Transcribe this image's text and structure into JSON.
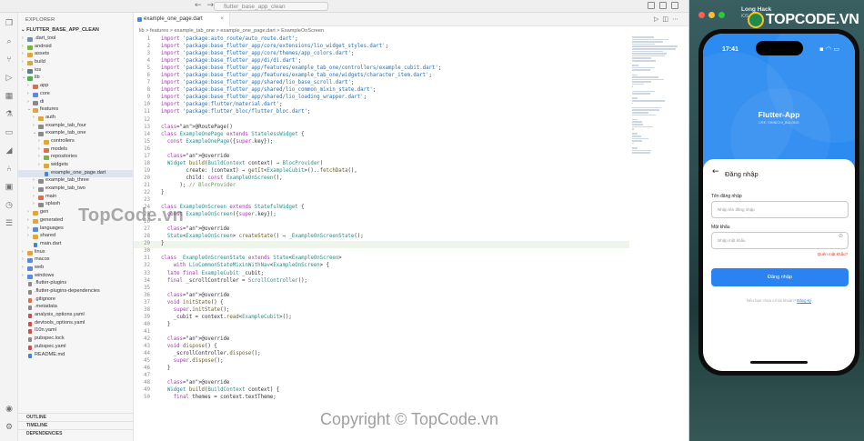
{
  "window": {
    "search_text": "flutter_base_app_clean"
  },
  "sidebar": {
    "title": "EXPLORER",
    "project": "FLUTTER_BASE_APP_CLEAN",
    "tree": [
      {
        "label": ".dart_tool",
        "depth": 0,
        "kind": "folder",
        "open": false,
        "color": "#6d8fbf"
      },
      {
        "label": "android",
        "depth": 0,
        "kind": "folder",
        "open": false,
        "color": "#7cb342"
      },
      {
        "label": "assets",
        "depth": 0,
        "kind": "folder",
        "open": false,
        "color": "#e3a43b"
      },
      {
        "label": "build",
        "depth": 0,
        "kind": "folder",
        "open": false,
        "color": "#e3a43b"
      },
      {
        "label": "ios",
        "depth": 0,
        "kind": "folder",
        "open": false,
        "color": "#607d8b"
      },
      {
        "label": "lib",
        "depth": 0,
        "kind": "folder",
        "open": true,
        "color": "#4caf50"
      },
      {
        "label": "app",
        "depth": 1,
        "kind": "folder",
        "open": false,
        "color": "#e06c4c"
      },
      {
        "label": "core",
        "depth": 1,
        "kind": "folder",
        "open": false,
        "color": "#5c8ad6"
      },
      {
        "label": "di",
        "depth": 1,
        "kind": "folder",
        "open": false,
        "color": "#8a8a8a"
      },
      {
        "label": "features",
        "depth": 1,
        "kind": "folder",
        "open": true,
        "color": "#e3a43b"
      },
      {
        "label": "auth",
        "depth": 2,
        "kind": "folder",
        "open": false,
        "color": "#e3a43b"
      },
      {
        "label": "example_tab_four",
        "depth": 2,
        "kind": "folder",
        "open": false,
        "color": "#8a8a8a"
      },
      {
        "label": "example_tab_one",
        "depth": 2,
        "kind": "folder",
        "open": true,
        "color": "#8a8a8a"
      },
      {
        "label": "controllers",
        "depth": 3,
        "kind": "folder",
        "open": false,
        "color": "#e3a43b"
      },
      {
        "label": "models",
        "depth": 3,
        "kind": "folder",
        "open": false,
        "color": "#e06c4c"
      },
      {
        "label": "repositories",
        "depth": 3,
        "kind": "folder",
        "open": false,
        "color": "#7cb342"
      },
      {
        "label": "widgets",
        "depth": 3,
        "kind": "folder",
        "open": false,
        "color": "#e3a43b"
      },
      {
        "label": "example_one_page.dart",
        "depth": 3,
        "kind": "dart",
        "open": false,
        "color": "#3c8ad9",
        "selected": true
      },
      {
        "label": "example_tab_three",
        "depth": 2,
        "kind": "folder",
        "open": false,
        "color": "#8a8a8a"
      },
      {
        "label": "example_tab_two",
        "depth": 2,
        "kind": "folder",
        "open": false,
        "color": "#8a8a8a"
      },
      {
        "label": "main",
        "depth": 2,
        "kind": "folder",
        "open": false,
        "color": "#e06c4c"
      },
      {
        "label": "splash",
        "depth": 2,
        "kind": "folder",
        "open": false,
        "color": "#8a8a8a"
      },
      {
        "label": "gen",
        "depth": 1,
        "kind": "folder",
        "open": false,
        "color": "#e3a43b"
      },
      {
        "label": "generated",
        "depth": 1,
        "kind": "folder",
        "open": false,
        "color": "#e3a43b"
      },
      {
        "label": "languages",
        "depth": 1,
        "kind": "folder",
        "open": false,
        "color": "#5c8ad6"
      },
      {
        "label": "shared",
        "depth": 1,
        "kind": "folder",
        "open": false,
        "color": "#e3a43b"
      },
      {
        "label": "main.dart",
        "depth": 1,
        "kind": "dart",
        "open": false,
        "color": "#3c8ad9"
      },
      {
        "label": "linux",
        "depth": 0,
        "kind": "folder",
        "open": false,
        "color": "#e3a43b"
      },
      {
        "label": "macos",
        "depth": 0,
        "kind": "folder",
        "open": false,
        "color": "#5c8ad6"
      },
      {
        "label": "web",
        "depth": 0,
        "kind": "folder",
        "open": false,
        "color": "#5c8ad6"
      },
      {
        "label": "windows",
        "depth": 0,
        "kind": "folder",
        "open": false,
        "color": "#5c8ad6"
      },
      {
        "label": ".flutter-plugins",
        "depth": 0,
        "kind": "file",
        "open": false,
        "color": "#8a8a8a"
      },
      {
        "label": ".flutter-plugins-dependencies",
        "depth": 0,
        "kind": "file",
        "open": false,
        "color": "#8a8a8a"
      },
      {
        "label": ".gitignore",
        "depth": 0,
        "kind": "file",
        "open": false,
        "color": "#e06c4c"
      },
      {
        "label": ".metadata",
        "depth": 0,
        "kind": "file",
        "open": false,
        "color": "#8a8a8a"
      },
      {
        "label": "analysis_options.yaml",
        "depth": 0,
        "kind": "file",
        "open": false,
        "color": "#c9534c"
      },
      {
        "label": "devtools_options.yaml",
        "depth": 0,
        "kind": "file",
        "open": false,
        "color": "#c9534c"
      },
      {
        "label": "l10n.yaml",
        "depth": 0,
        "kind": "file",
        "open": false,
        "color": "#c9534c"
      },
      {
        "label": "pubspec.lock",
        "depth": 0,
        "kind": "file",
        "open": false,
        "color": "#8a8a8a"
      },
      {
        "label": "pubspec.yaml",
        "depth": 0,
        "kind": "file",
        "open": false,
        "color": "#c9534c"
      },
      {
        "label": "README.md",
        "depth": 0,
        "kind": "file",
        "open": false,
        "color": "#3c8ad9"
      }
    ],
    "bottom_sections": [
      "OUTLINE",
      "TIMELINE",
      "DEPENDENCIES"
    ]
  },
  "editor": {
    "tab_label": "example_one_page.dart",
    "breadcrumb": "lib > features > example_tab_one > example_one_page.dart > ExampleOnScreen",
    "current_line": 29,
    "lines": [
      {
        "n": 1,
        "code": "import 'package:auto_route/auto_route.dart';"
      },
      {
        "n": 2,
        "code": "import 'package:base_flutter_app/core/extensions/lio_widget_styles.dart';"
      },
      {
        "n": 3,
        "code": "import 'package:base_flutter_app/core/themes/app_colors.dart';"
      },
      {
        "n": 4,
        "code": "import 'package:base_flutter_app/di/di.dart';"
      },
      {
        "n": 5,
        "code": "import 'package:base_flutter_app/features/example_tab_one/controllers/example_cubit.dart';"
      },
      {
        "n": 6,
        "code": "import 'package:base_flutter_app/features/example_tab_one/widgets/character_item.dart';"
      },
      {
        "n": 7,
        "code": "import 'package:base_flutter_app/shared/lio_base_scroll.dart';"
      },
      {
        "n": 8,
        "code": "import 'package:base_flutter_app/shared/lio_common_mixin_state.dart';"
      },
      {
        "n": 9,
        "code": "import 'package:base_flutter_app/shared/lio_loading_wrapper.dart';"
      },
      {
        "n": 10,
        "code": "import 'package:flutter/material.dart';"
      },
      {
        "n": 11,
        "code": "import 'package:flutter_bloc/flutter_bloc.dart';"
      },
      {
        "n": 12,
        "code": ""
      },
      {
        "n": 13,
        "code": "@RoutePage()"
      },
      {
        "n": 14,
        "code": "class ExampleOnePage extends StatelessWidget {"
      },
      {
        "n": 15,
        "code": "  const ExampleOnePage({super.key});"
      },
      {
        "n": 16,
        "code": ""
      },
      {
        "n": 17,
        "code": "  @override"
      },
      {
        "n": 18,
        "code": "  Widget build(BuildContext context) ⇒ BlocProvider("
      },
      {
        "n": 19,
        "code": "        create: (context) ⇒ getIt<ExampleCubit>()..fetchData(),"
      },
      {
        "n": 20,
        "code": "        child: const ExampleOnScreen(),"
      },
      {
        "n": 21,
        "code": "      ); // BlocProvider"
      },
      {
        "n": 22,
        "code": "}"
      },
      {
        "n": 23,
        "code": ""
      },
      {
        "n": 24,
        "code": "class ExampleOnScreen extends StatefulWidget {"
      },
      {
        "n": 25,
        "code": "  const ExampleOnScreen({super.key});"
      },
      {
        "n": 26,
        "code": ""
      },
      {
        "n": 27,
        "code": "  @override"
      },
      {
        "n": 28,
        "code": "  State<ExampleOnScreen> createState() ⇒ _ExampleOnScreenState();"
      },
      {
        "n": 29,
        "code": "}"
      },
      {
        "n": 30,
        "code": ""
      },
      {
        "n": 31,
        "code": "class _ExampleOnScreenState extends State<ExampleOnScreen>"
      },
      {
        "n": 32,
        "code": "    with LioCommonStateMixinWithNav<ExampleOnScreen> {"
      },
      {
        "n": 33,
        "code": "  late final ExampleCubit _cubit;"
      },
      {
        "n": 34,
        "code": "  final _scrollController = ScrollController();"
      },
      {
        "n": 35,
        "code": ""
      },
      {
        "n": 36,
        "code": "  @override"
      },
      {
        "n": 37,
        "code": "  void initState() {"
      },
      {
        "n": 38,
        "code": "    super.initState();"
      },
      {
        "n": 39,
        "code": "    _cubit = context.read<ExampleCubit>();"
      },
      {
        "n": 40,
        "code": "  }"
      },
      {
        "n": 41,
        "code": ""
      },
      {
        "n": 42,
        "code": "  @override"
      },
      {
        "n": 43,
        "code": "  void dispose() {"
      },
      {
        "n": 44,
        "code": "    _scrollController.dispose();"
      },
      {
        "n": 45,
        "code": "    super.dispose();"
      },
      {
        "n": 46,
        "code": "  }"
      },
      {
        "n": 47,
        "code": ""
      },
      {
        "n": 48,
        "code": "  @override"
      },
      {
        "n": 49,
        "code": "  Widget build(BuildContext context) {"
      },
      {
        "n": 50,
        "code": "    final themes = context.textTheme;"
      }
    ]
  },
  "simulator": {
    "title": "Long Hack",
    "subtitle": "iOS 18.0",
    "status_time": "17:41",
    "app_title": "Flutter-App",
    "app_subtitle": "CRE: SHINICHI_BULONG",
    "screen_title": "Đăng nhập",
    "username_label": "Tên đăng nhập",
    "username_placeholder": "Nhập tên đăng nhập",
    "password_label": "Mật khẩu",
    "password_placeholder": "Nhập mật khẩu",
    "forgot_password": "Quên mật khẩu?",
    "login_button": "Đăng nhập",
    "signup_prompt": "Nếu bạn chưa có tài khoản?",
    "signup_link": "Đăng ký",
    "accent_color": "#2b83f2"
  },
  "logo": {
    "text": "TOPCODE.VN"
  },
  "watermark": {
    "small": "TopCode.vn",
    "large": "Copyright © TopCode.vn"
  }
}
